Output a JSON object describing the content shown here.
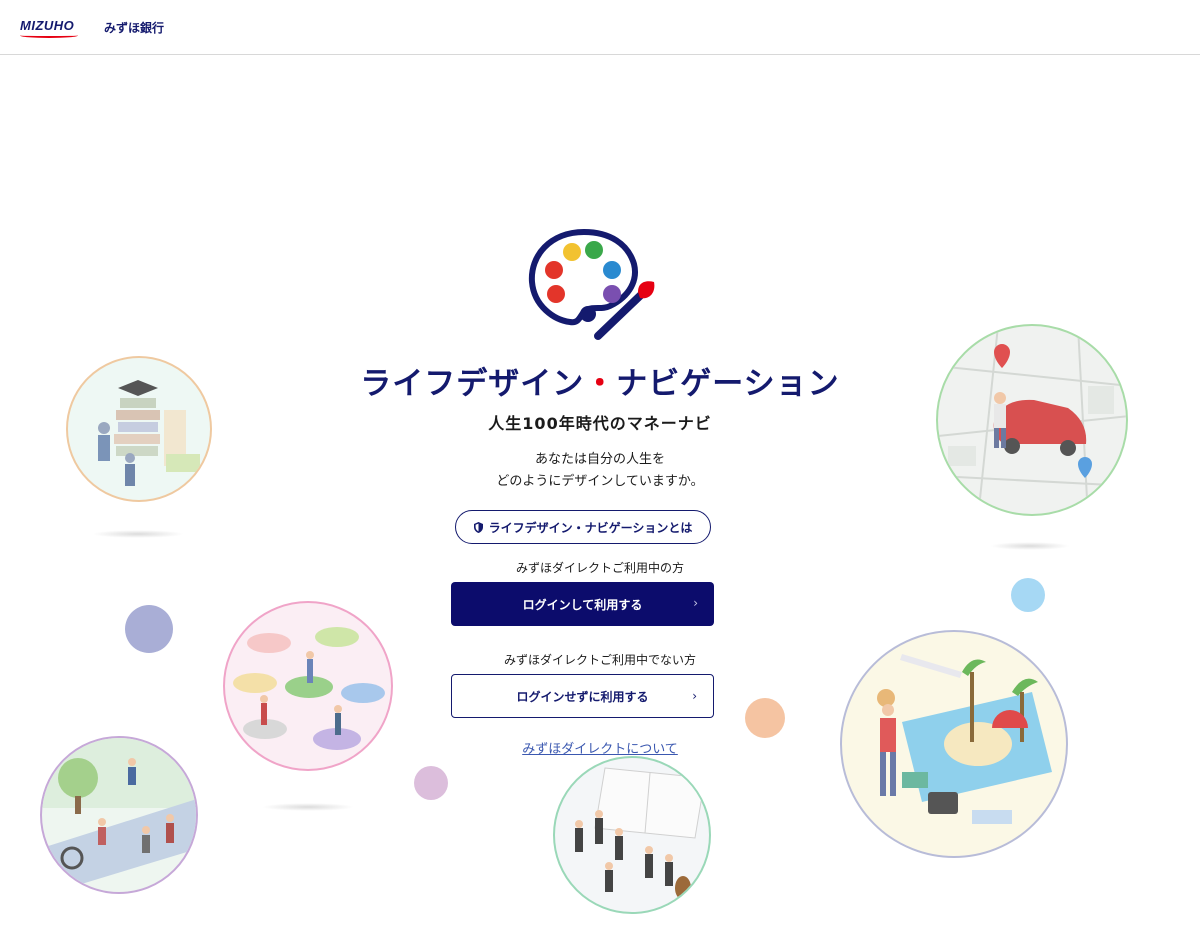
{
  "header": {
    "brand": "MIZUHO",
    "bank_name": "みずほ銀行"
  },
  "app": {
    "title_part1": "ライフデザイン",
    "title_sep": "・",
    "title_part2": "ナビゲーション",
    "subtitle": "人生100年時代のマネーナビ",
    "lead_line1": "あなたは自分の人生を",
    "lead_line2": "どのようにデザインしていますか。"
  },
  "actions": {
    "about_label": "ライフデザイン・ナビゲーションとは",
    "user_label": "みずほダイレクトご利用中の方",
    "login_label": "ログインして利用する",
    "nonuser_label": "みずほダイレクトご利用中でない方",
    "guest_label": "ログインせずに利用する",
    "chevron": "›",
    "direct_link": "みずほダイレクトについて"
  },
  "icons": {
    "logo": "life-palette-logo",
    "about": "shield-icon",
    "chevron": "chevron-right-icon"
  },
  "colors": {
    "navy": "#141a6e",
    "button_dark": "#0c0c6c",
    "accent_red": "#e60012",
    "link": "#3b58b0"
  }
}
